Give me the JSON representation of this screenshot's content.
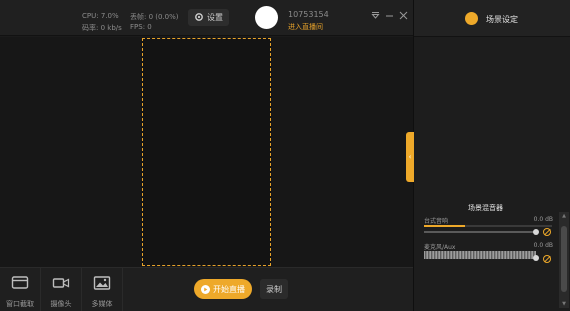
{
  "topbar": {
    "cpu_label": "CPU: 7.0%",
    "loss_label": "丢帧: 0 (0.0%)",
    "bitrate_label": "码率: 0 kb/s",
    "fps_label": "FPS: 0",
    "settings_label": "设置",
    "room_id": "10753154",
    "room_link": "进入直播间"
  },
  "canvas": {},
  "bottombar": {
    "sources": [
      {
        "label": "窗口截取",
        "icon": "window-capture-icon"
      },
      {
        "label": "摄像头",
        "icon": "camera-icon"
      },
      {
        "label": "多媒体",
        "icon": "image-icon"
      }
    ],
    "start_live_label": "开始直播",
    "record_label": "录制"
  },
  "side": {
    "title": "场景设定",
    "mixer_title": "场景混音器",
    "channels": [
      {
        "name": "台式音响",
        "db": "0.0 dB",
        "level": 0.32,
        "volume": 1.0
      },
      {
        "name": "麦克风/Aux",
        "db": "0.0 dB",
        "level": 0.3,
        "volume": 1.0
      }
    ]
  },
  "colors": {
    "accent": "#eea92a",
    "background": "#1b1b1b",
    "panel": "#1d1d1d"
  }
}
